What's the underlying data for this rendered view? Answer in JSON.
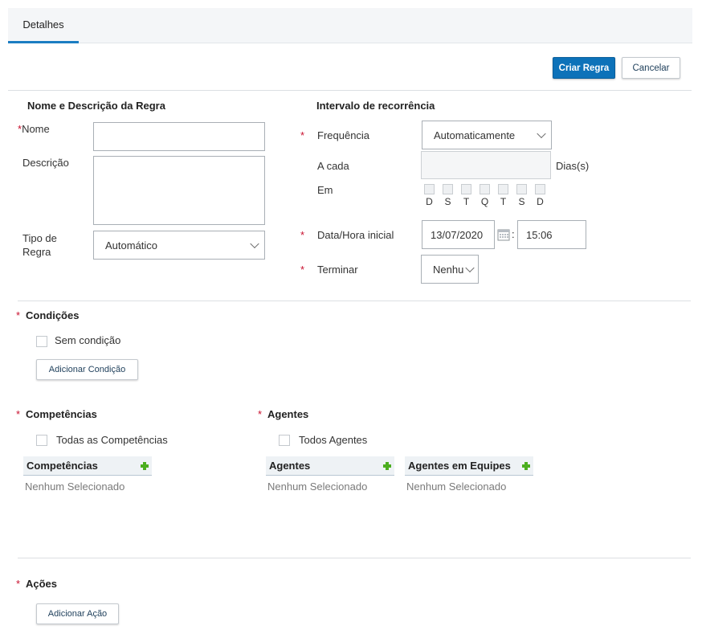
{
  "tabs": [
    {
      "label": "Detalhes"
    }
  ],
  "toolbar": {
    "create_label": "Criar Regra",
    "cancel_label": "Cancelar"
  },
  "rule": {
    "section_title": "Nome e Descrição da Regra",
    "name_label": "Nome",
    "name_value": "",
    "description_label": "Descrição",
    "description_value": "",
    "type_label_line1": "Tipo de",
    "type_label_line2": "Regra",
    "type_value": "Automático"
  },
  "recurrence": {
    "section_title": "Intervalo de recorrência",
    "frequency_label": "Frequência",
    "frequency_value": "Automaticamente",
    "every_label": "A cada",
    "every_value": "",
    "every_unit": "Dias(s)",
    "on_label": "Em",
    "days": [
      "D",
      "S",
      "T",
      "Q",
      "T",
      "S",
      "D"
    ],
    "start_label": "Data/Hora inicial",
    "start_date": "13/07/2020",
    "time_separator": ":",
    "start_time": "15:06",
    "end_label": "Terminar",
    "end_value": "Nenhu"
  },
  "conditions": {
    "title": "Condições",
    "no_condition_label": "Sem condição",
    "add_label": "Adicionar Condição"
  },
  "skills": {
    "title": "Competências",
    "all_label": "Todas as Competências",
    "grid_header": "Competências",
    "empty_text": "Nenhum Selecionado"
  },
  "agents": {
    "title": "Agentes",
    "all_label": "Todos Agentes",
    "grid_header": "Agentes",
    "empty_text": "Nenhum Selecionado",
    "teams_header": "Agentes em Equipes",
    "teams_empty_text": "Nenhum Selecionado"
  },
  "actions": {
    "title": "Ações",
    "add_label": "Adicionar Ação"
  },
  "required_marker": "*",
  "colors": {
    "accent": "#0d72b9",
    "required": "#c8102e",
    "add_icon": "#4cae1f"
  }
}
